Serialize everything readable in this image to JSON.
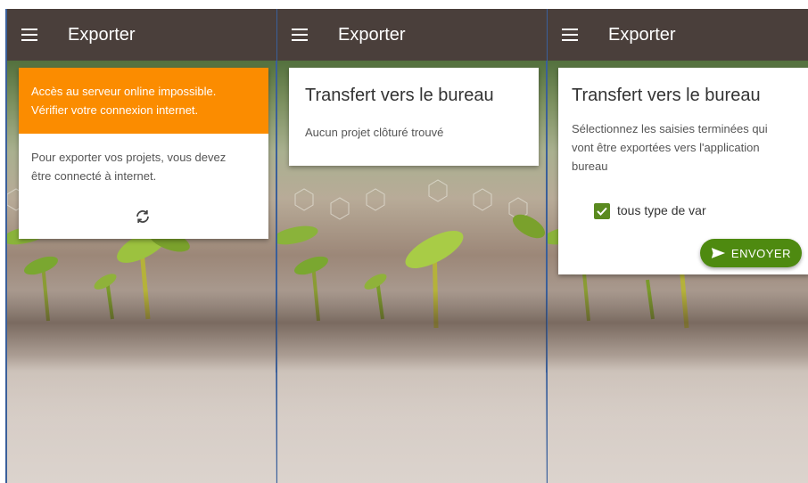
{
  "screens": [
    {
      "appbar": {
        "title": "Exporter"
      },
      "error_banner": {
        "line1": "Accès au serveur online impossible.",
        "line2": "Vérifier votre connexion internet."
      },
      "body": {
        "line1": "Pour exporter vos projets, vous devez",
        "line2": "être connecté à internet."
      },
      "refresh_icon": "refresh-icon"
    },
    {
      "appbar": {
        "title": "Exporter"
      },
      "card": {
        "title": "Transfert vers le bureau",
        "message": "Aucun projet clôturé trouvé"
      }
    },
    {
      "appbar": {
        "title": "Exporter"
      },
      "card": {
        "title": "Transfert vers le bureau",
        "desc_line1": "Sélectionnez les saisies terminées qui",
        "desc_line2": "vont être exportées vers l'application",
        "desc_line3": "bureau",
        "checkbox_label": "tous type de var",
        "checkbox_checked": true,
        "send_label": "ENVOYER"
      }
    }
  ],
  "colors": {
    "appbar": "#4a3f3b",
    "error_banner": "#fb8c00",
    "accent_green": "#4e8a10",
    "screen_border": "#3a5f9a"
  }
}
